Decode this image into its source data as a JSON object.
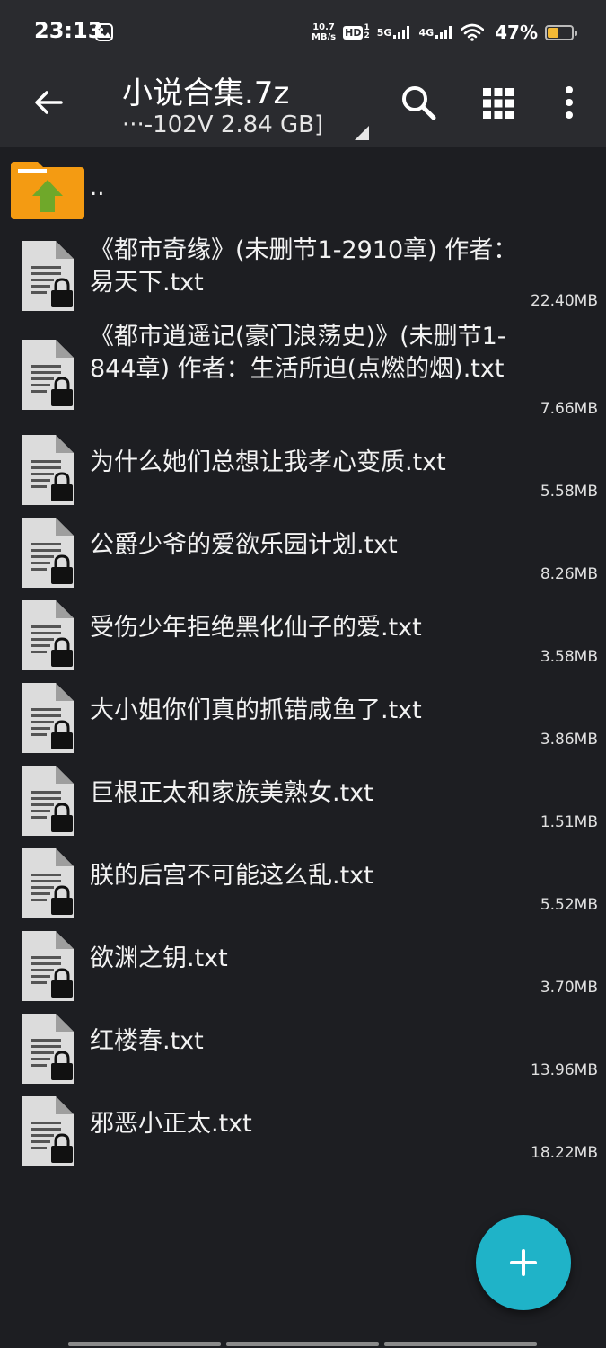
{
  "status_bar": {
    "time": "23:13",
    "net_speed_value": "10.7",
    "net_speed_unit": "MB/s",
    "hd_label": "HD",
    "signal1_label": "5G",
    "signal2_label": "4G",
    "battery_percent": "47%",
    "battery_level": 0.47,
    "battery_color": "#f3b936"
  },
  "toolbar": {
    "title": "小说合集.7z",
    "subtitle": "···-102V 2.84 GB]",
    "back_icon": "arrow-left-icon",
    "search_icon": "search-icon",
    "grid_icon": "grid-view-icon",
    "more_icon": "more-vert-icon"
  },
  "parent_dir": {
    "label": ".."
  },
  "files": [
    {
      "name": "《都市奇缘》(未删节1-2910章) 作者：易天下.txt",
      "size": "22.40MB"
    },
    {
      "name": "《都市逍遥记(豪门浪荡史)》(未删节1-844章) 作者：生活所迫(点燃的烟).txt",
      "size": "7.66MB"
    },
    {
      "name": "为什么她们总想让我孝心变质.txt",
      "size": "5.58MB"
    },
    {
      "name": "公爵少爷的爱欲乐园计划.txt",
      "size": "8.26MB"
    },
    {
      "name": "受伤少年拒绝黑化仙子的爱.txt",
      "size": "3.58MB"
    },
    {
      "name": "大小姐你们真的抓错咸鱼了.txt",
      "size": "3.86MB"
    },
    {
      "name": "巨根正太和家族美熟女.txt",
      "size": "1.51MB"
    },
    {
      "name": "朕的后宫不可能这么乱.txt",
      "size": "5.52MB"
    },
    {
      "name": "欲渊之钥.txt",
      "size": "3.70MB"
    },
    {
      "name": "红楼春.txt",
      "size": "13.96MB"
    },
    {
      "name": "邪恶小正太.txt",
      "size": "18.22MB"
    }
  ],
  "fab": {
    "icon": "plus-icon",
    "color": "#1fb3c8"
  }
}
